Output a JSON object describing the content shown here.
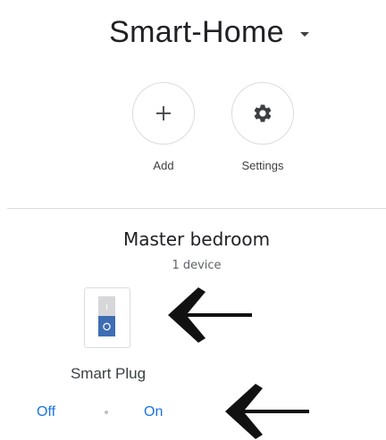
{
  "header": {
    "home_name": "Smart-Home",
    "home_dropdown_icon": "caret-down-icon"
  },
  "actions": [
    {
      "label": "Add",
      "icon": "plus-icon"
    },
    {
      "label": "Settings",
      "icon": "gear-icon"
    }
  ],
  "room": {
    "name": "Master bedroom",
    "device_count": "1 device"
  },
  "device": {
    "name": "Smart Plug",
    "icon": "smart-plug-switch-icon",
    "off_label": "Off",
    "on_label": "On",
    "switch_top_symbol": "I",
    "switch_bottom_symbol": "O"
  },
  "annotations": [
    {
      "icon": "left-arrow-icon",
      "color": "#111111"
    },
    {
      "icon": "left-arrow-icon",
      "color": "#111111"
    }
  ],
  "colors": {
    "accent": "#1a73e8",
    "switch_on": "#3f6db4",
    "switch_off": "#d7d7da",
    "divider": "#dadce0"
  }
}
